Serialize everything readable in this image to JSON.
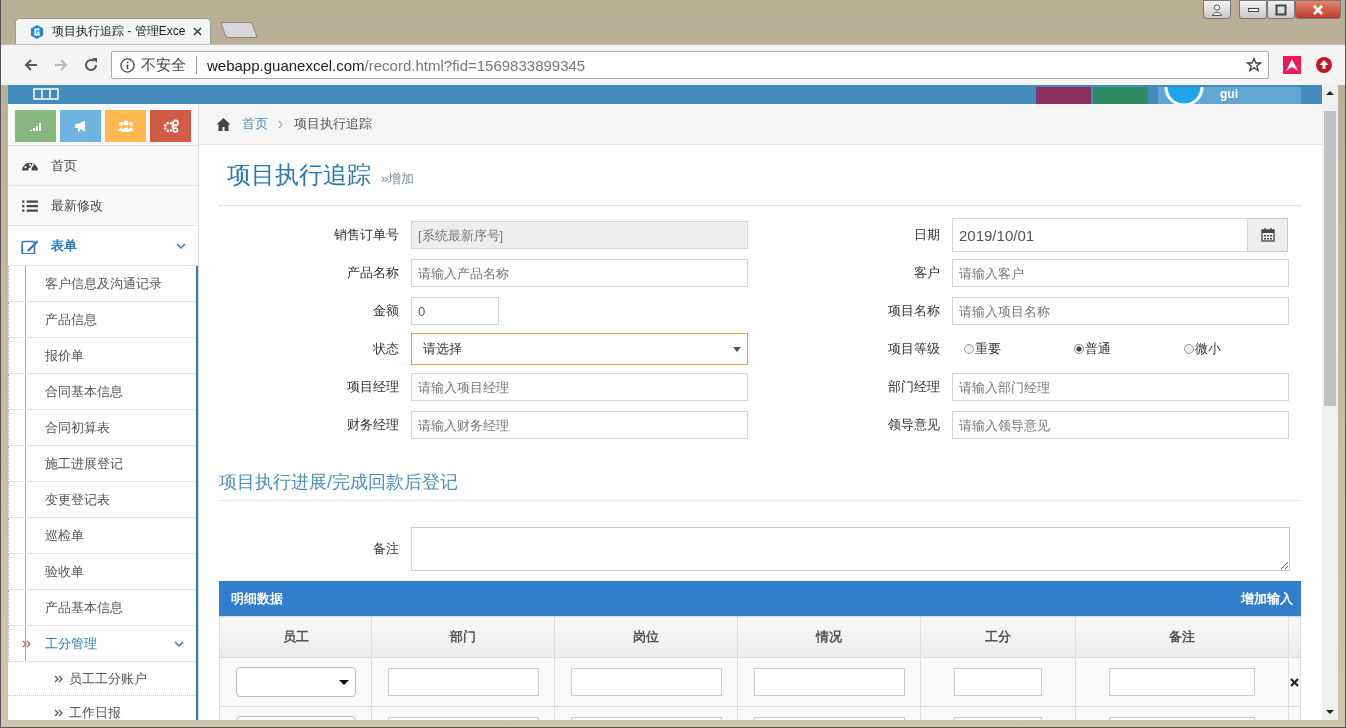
{
  "browser": {
    "tab_title": "项目执行追踪 - 管理Exce",
    "security": "不安全",
    "url_host": "webapp.guanexcel.com",
    "url_path": "/record.html?fid=1569833899345"
  },
  "header": {
    "user": "gui"
  },
  "sidebar": {
    "items": [
      {
        "label": "首页",
        "selected": false
      },
      {
        "label": "最新修改",
        "selected": false
      },
      {
        "label": "表单",
        "selected": true,
        "expanded": true,
        "children": [
          {
            "label": "客户信息及沟通记录",
            "selected": false
          },
          {
            "label": "产品信息",
            "selected": false
          },
          {
            "label": "报价单",
            "selected": false
          },
          {
            "label": "合同基本信息",
            "selected": false
          },
          {
            "label": "合同初算表",
            "selected": false
          },
          {
            "label": "施工进展登记",
            "selected": false
          },
          {
            "label": "变更登记表",
            "selected": false
          },
          {
            "label": "巡检单",
            "selected": false
          },
          {
            "label": "验收单",
            "selected": false
          },
          {
            "label": "产品基本信息",
            "selected": false
          },
          {
            "label": "工分管理",
            "selected": true,
            "expanded": true,
            "children": [
              {
                "label": "员工工分账户",
                "selected": false
              },
              {
                "label": "工作日报",
                "selected": false
              }
            ]
          }
        ]
      }
    ]
  },
  "breadcrumb": [
    {
      "label": "首页",
      "kind": "link"
    },
    {
      "label": "项目执行追踪",
      "kind": "current"
    }
  ],
  "page_title": "项目执行追踪",
  "page_subtitle": "»增加",
  "form": {
    "fields": [
      {
        "label": "销售订单号",
        "kind": "text",
        "placeholder": "[系统最新序号]",
        "disabled": true
      },
      {
        "label": "日期",
        "kind": "date",
        "value": "2019/10/01"
      },
      {
        "label": "产品名称",
        "kind": "text",
        "placeholder": "请输入产品名称",
        "disabled": false
      },
      {
        "label": "客户",
        "kind": "text",
        "placeholder": "请输入客户",
        "disabled": false
      },
      {
        "label": "金额",
        "kind": "number",
        "value": "0"
      },
      {
        "label": "项目名称",
        "kind": "text",
        "placeholder": "请输入项目名称",
        "disabled": false
      },
      {
        "label": "状态",
        "kind": "select",
        "value": "请选择",
        "focused": true
      },
      {
        "label": "项目等级",
        "kind": "radio",
        "options": [
          {
            "label": "重要",
            "selected": false
          },
          {
            "label": "普通",
            "selected": true
          },
          {
            "label": "微小",
            "selected": false
          }
        ]
      },
      {
        "label": "项目经理",
        "kind": "text",
        "placeholder": "请输入项目经理",
        "disabled": false
      },
      {
        "label": "部门经理",
        "kind": "text",
        "placeholder": "请输入部门经理",
        "disabled": false
      },
      {
        "label": "财务经理",
        "kind": "text",
        "placeholder": "请输入财务经理",
        "disabled": false
      },
      {
        "label": "领导意见",
        "kind": "text",
        "placeholder": "请输入领导意见",
        "disabled": false
      }
    ]
  },
  "section_title": "项目执行进展/完成回款后登记",
  "notes": {
    "label": "备注"
  },
  "detail": {
    "title": "明细数据",
    "action": "增加输入",
    "columns": [
      {
        "label": "员工",
        "kind": "select"
      },
      {
        "label": "部门",
        "kind": "input"
      },
      {
        "label": "岗位",
        "kind": "input"
      },
      {
        "label": "情况",
        "kind": "input"
      },
      {
        "label": "工分",
        "kind": "input"
      },
      {
        "label": "备注",
        "kind": "input"
      }
    ],
    "rows": [
      {
        "kind": "entry"
      },
      {
        "kind": "partial"
      }
    ]
  }
}
